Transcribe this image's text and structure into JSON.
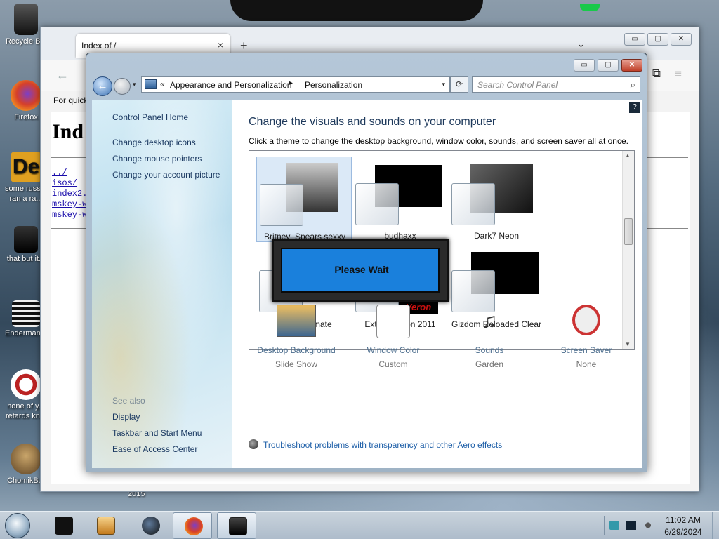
{
  "desktop": {
    "icons": [
      {
        "label": "Recycle Bin",
        "icon": "recycle-bin-icon"
      },
      {
        "label": "Firefox",
        "icon": "firefox-icon"
      },
      {
        "label": "some russ... ran a ra...",
        "icon": "de-app-icon"
      },
      {
        "label": "that but it...",
        "icon": "stacked-windows-icon"
      },
      {
        "label": "Enderman...",
        "icon": "enderman-icon"
      },
      {
        "label": "none of y... retards kn...",
        "icon": "red-circle-icon"
      },
      {
        "label": "ChomikB...",
        "icon": "chomik-icon"
      }
    ],
    "year_label": "2015"
  },
  "firefox": {
    "tab_title": "Index of /",
    "tab_close": "×",
    "new_tab": "+",
    "tab_list": "⌄",
    "window_controls": {
      "minimize": "▭",
      "maximize": "▢",
      "close": "✕"
    },
    "back": "←",
    "menu": "≡",
    "extensions": "⧉",
    "bookmarks_text": "For quick",
    "page_heading": "Ind",
    "links": [
      "../",
      "isos/",
      "index2.",
      "mskey-w",
      "mskey-w"
    ],
    "right_stubs": [
      "-",
      "-",
      "-",
      "-",
      "-"
    ]
  },
  "control_panel": {
    "window_controls": {
      "minimize": "▭",
      "maximize": "▢",
      "close": "✕"
    },
    "nav": {
      "back": "←",
      "recent": "▾"
    },
    "address": {
      "chevron": "«",
      "crumbs": [
        "Appearance and Personalization",
        "Personalization"
      ],
      "separator": "▸",
      "dropdown": "▾",
      "refresh": "⟳"
    },
    "search": {
      "placeholder": "Search Control Panel",
      "icon": "⌕"
    },
    "help": "?",
    "sidebar": {
      "home": "Control Panel Home",
      "links": [
        "Change desktop icons",
        "Change mouse pointers",
        "Change your account picture"
      ],
      "see_also_title": "See also",
      "see_also": [
        "Display",
        "Taskbar and Start Menu",
        "Ease of Access Center"
      ]
    },
    "heading": "Change the visuals and sounds on your computer",
    "subheading": "Click a theme to change the desktop background, window color, sounds, and screen saver all at once.",
    "themes": [
      {
        "name": "Britney_Spears sexxy",
        "selected": true
      },
      {
        "name": "budhaxx",
        "selected": false
      },
      {
        "name": "Dark7 Neon",
        "selected": false
      },
      {
        "name": "Dark7 Ultimate",
        "selected": false
      },
      {
        "name": "Extreme Tron 2011",
        "selected": false
      },
      {
        "name": "Gizdom Reloaded Clear",
        "selected": false
      }
    ],
    "theme_overlay_text": "Veron",
    "scroll": {
      "up": "▲",
      "down": "▼"
    },
    "please_wait": "Please Wait",
    "bottom": [
      {
        "title": "Desktop Background",
        "value": "Slide Show",
        "icon": "desktop-background-icon"
      },
      {
        "title": "Window Color",
        "value": "Custom",
        "icon": "window-color-icon"
      },
      {
        "title": "Sounds",
        "value": "Garden",
        "icon": "sounds-icon"
      },
      {
        "title": "Screen Saver",
        "value": "None",
        "icon": "screen-saver-icon"
      }
    ],
    "troubleshoot": "Troubleshoot problems with transparency and other Aero effects"
  },
  "taskbar": {
    "time": "11:02 AM",
    "date": "6/29/2024",
    "apps": [
      "black-box-icon",
      "media-player-icon",
      "globe-icon",
      "firefox-icon",
      "control-panel-icon"
    ]
  }
}
